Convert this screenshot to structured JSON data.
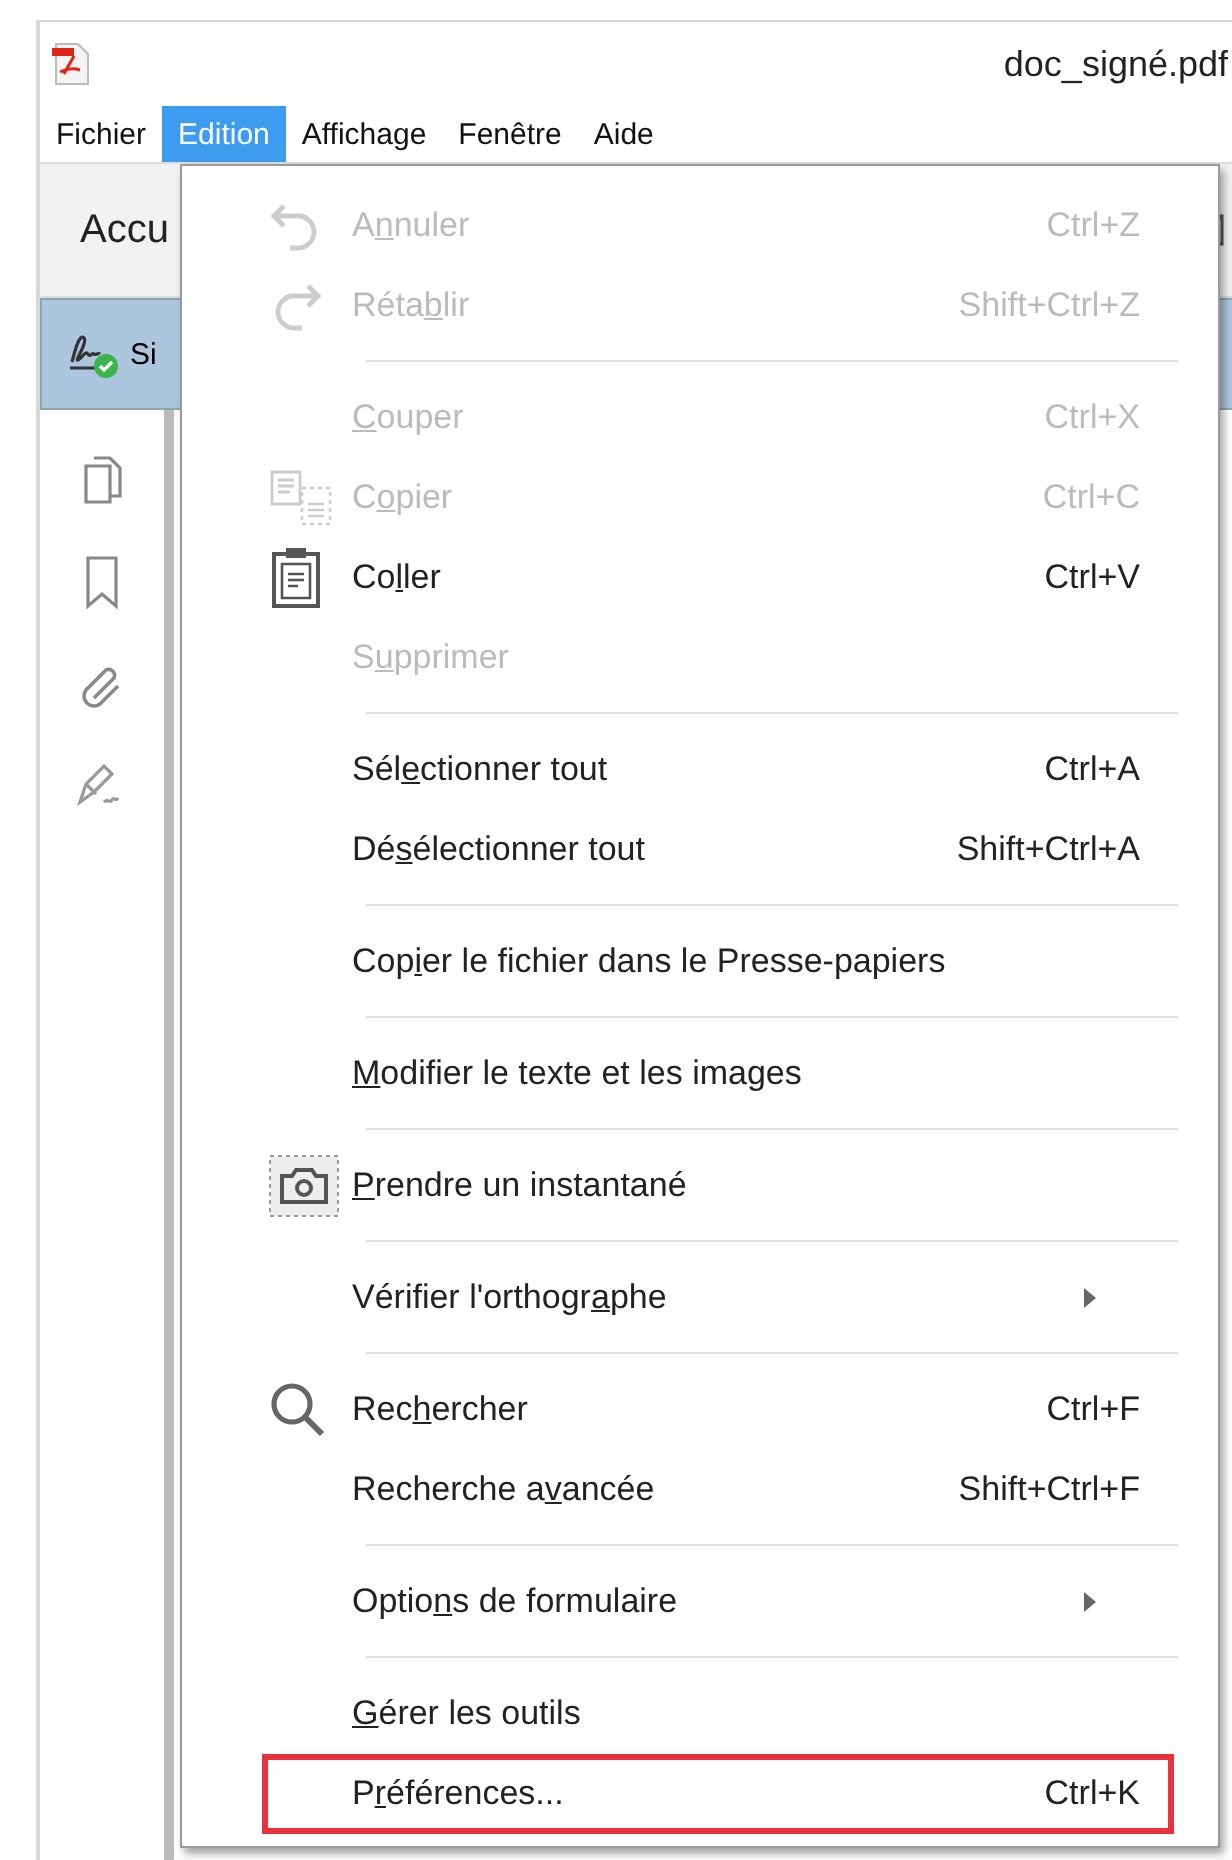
{
  "window": {
    "title": "doc_signé.pdf"
  },
  "menu_bar": [
    {
      "label": "Fichier",
      "selected": false
    },
    {
      "label": "Edition",
      "selected": true
    },
    {
      "label": "Affichage",
      "selected": false
    },
    {
      "label": "Fenêtre",
      "selected": false
    },
    {
      "label": "Aide",
      "selected": false
    }
  ],
  "toolbar": {
    "label": "Accu"
  },
  "signature_bar": {
    "label": "Si"
  },
  "edit_menu": {
    "sections": [
      {
        "items": [
          {
            "kind": "undo",
            "label": {
              "before": "A",
              "key": "n",
              "after": "nuler"
            },
            "shortcut": "Ctrl+Z",
            "disabled": true,
            "highlighted": false
          },
          {
            "kind": "redo",
            "label": {
              "before": "Réta",
              "key": "b",
              "after": "lir"
            },
            "shortcut": "Shift+Ctrl+Z",
            "disabled": true,
            "highlighted": false
          }
        ]
      },
      {
        "items": [
          {
            "kind": "plain",
            "label": {
              "key": "C",
              "after": "ouper"
            },
            "shortcut": "Ctrl+X",
            "disabled": true,
            "highlighted": false
          },
          {
            "kind": "copy",
            "label": {
              "before": "C",
              "key": "o",
              "after": "pier"
            },
            "shortcut": "Ctrl+C",
            "disabled": true,
            "highlighted": false
          },
          {
            "kind": "paste",
            "label": {
              "before": "Co",
              "key": "l",
              "after": "ler"
            },
            "shortcut": "Ctrl+V",
            "disabled": false,
            "highlighted": false
          },
          {
            "kind": "plain",
            "label": {
              "before": "S",
              "key": "u",
              "after": "pprimer"
            },
            "disabled": true,
            "highlighted": false
          }
        ]
      },
      {
        "items": [
          {
            "kind": "plain",
            "label": {
              "before": "Sél",
              "key": "e",
              "after": "ctionner tout"
            },
            "shortcut": "Ctrl+A",
            "disabled": false,
            "highlighted": false
          },
          {
            "kind": "plain",
            "label": {
              "before": "Dé",
              "key": "s",
              "after": "électionner tout"
            },
            "shortcut": "Shift+Ctrl+A",
            "disabled": false,
            "highlighted": false
          }
        ]
      },
      {
        "items": [
          {
            "kind": "plain",
            "label": {
              "before": "Cop",
              "key": "i",
              "after": "er le fichier dans le Presse-papiers"
            },
            "disabled": false,
            "highlighted": false
          }
        ]
      },
      {
        "items": [
          {
            "kind": "plain",
            "label": {
              "key": "M",
              "after": "odifier le texte et les images"
            },
            "disabled": false,
            "highlighted": false
          }
        ]
      },
      {
        "items": [
          {
            "kind": "camera",
            "label": {
              "key": "P",
              "after": "rendre un instantané"
            },
            "disabled": false,
            "highlighted": false
          }
        ]
      },
      {
        "items": [
          {
            "kind": "submenu",
            "label": {
              "before": "Vérifier l'orthogr",
              "key": "a",
              "after": "phe"
            },
            "disabled": false,
            "highlighted": false
          }
        ]
      },
      {
        "items": [
          {
            "kind": "search",
            "label": {
              "before": "Rec",
              "key": "h",
              "after": "ercher"
            },
            "shortcut": "Ctrl+F",
            "disabled": false,
            "highlighted": false
          },
          {
            "kind": "plain",
            "label": {
              "before": "Recherche a",
              "key": "v",
              "after": "ancée"
            },
            "shortcut": "Shift+Ctrl+F",
            "disabled": false,
            "highlighted": false
          }
        ]
      },
      {
        "items": [
          {
            "kind": "submenu",
            "label": {
              "before": "Optio",
              "key": "n",
              "after": "s de formulaire"
            },
            "disabled": false,
            "highlighted": false
          }
        ]
      },
      {
        "items": [
          {
            "kind": "plain",
            "label": {
              "key": "G",
              "after": "érer les outils"
            },
            "disabled": false,
            "highlighted": false
          },
          {
            "kind": "plain",
            "label": {
              "before": "P",
              "key": "r",
              "after": "éférences..."
            },
            "shortcut": "Ctrl+K",
            "disabled": false,
            "highlighted": true
          }
        ]
      }
    ]
  }
}
